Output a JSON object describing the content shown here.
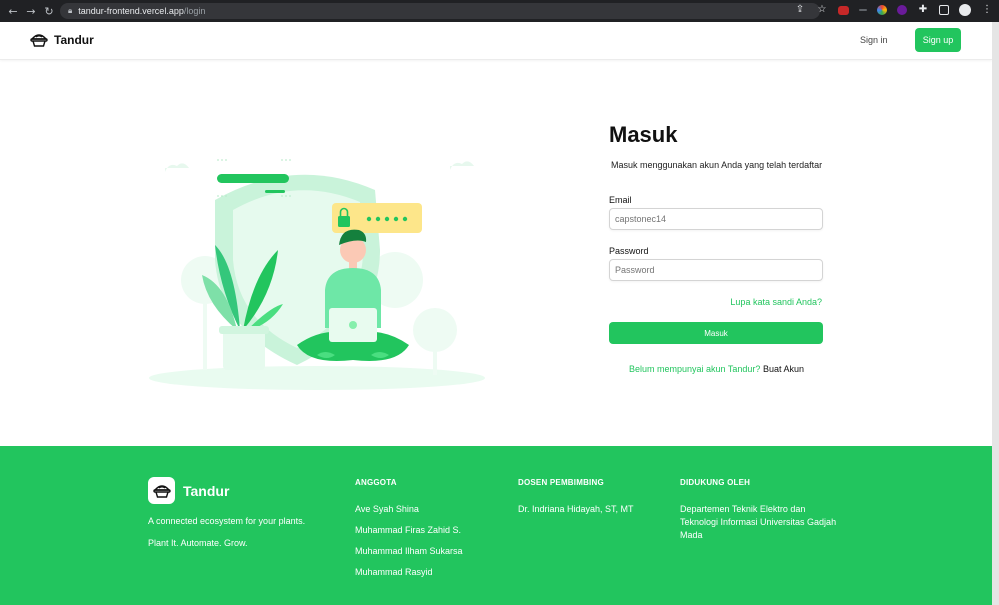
{
  "browser": {
    "url_host": "tandur-frontend.vercel.app",
    "url_path": "/login"
  },
  "navbar": {
    "brand": "Tandur",
    "signin": "Sign in",
    "signup": "Sign up"
  },
  "login": {
    "title": "Masuk",
    "subtitle": "Masuk menggunakan akun Anda yang telah terdaftar",
    "email_label": "Email",
    "email_placeholder": "capstonec14",
    "password_label": "Password",
    "password_placeholder": "Password",
    "forgot": "Lupa kata sandi Anda?",
    "submit": "Masuk",
    "register_question": "Belum mempunyai akun Tandur?",
    "register_link": "Buat Akun"
  },
  "footer": {
    "brand": "Tandur",
    "tagline": "A connected ecosystem for your plants.",
    "motto": "Plant It. Automate. Grow.",
    "anggota_heading": "ANGGOTA",
    "anggota": [
      "Ave Syah Shina",
      "Muhammad Firas Zahid S.",
      "Muhammad Ilham Sukarsa",
      "Muhammad Rasyid"
    ],
    "dosen_heading": "DOSEN PEMBIMBING",
    "dosen": [
      "Dr. Indriana Hidayah, ST, MT"
    ],
    "didukung_heading": "DIDUKUNG OLEH",
    "didukung": [
      "Departemen Teknik Elektro dan Teknologi Informasi Universitas Gadjah Mada"
    ]
  },
  "colors": {
    "brand_green": "#22c55e",
    "light_green": "#b8f2cf"
  },
  "icons": [
    "back-icon",
    "forward-icon",
    "reload-icon",
    "lock-icon",
    "share-icon",
    "star-icon",
    "puzzle-icon",
    "sidebar-icon",
    "profile-icon",
    "menu-icon",
    "tandur-logo-icon",
    "padlock-icon"
  ]
}
